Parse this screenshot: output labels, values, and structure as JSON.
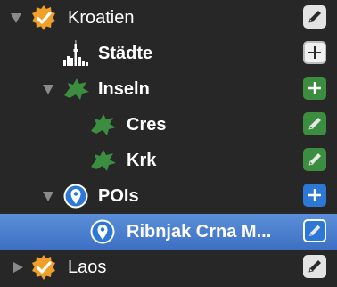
{
  "tree": {
    "items": [
      {
        "label": "Kroatien",
        "icon": "checkmark-badge-icon",
        "action": "edit-icon"
      },
      {
        "label": "Städte",
        "icon": "city-skyline-icon",
        "action": "add-icon"
      },
      {
        "label": "Inseln",
        "icon": "island-icon",
        "action": "add-icon"
      },
      {
        "label": "Cres",
        "icon": "island-icon",
        "action": "edit-icon"
      },
      {
        "label": "Krk",
        "icon": "island-icon",
        "action": "edit-icon"
      },
      {
        "label": "POIs",
        "icon": "location-pin-icon",
        "action": "add-icon"
      },
      {
        "label": "Ribnjak Crna M...",
        "icon": "location-pin-icon",
        "action": "edit-icon",
        "selected": true
      },
      {
        "label": "Laos",
        "icon": "checkmark-badge-icon",
        "action": "edit-icon"
      }
    ]
  },
  "colors": {
    "background": "#272727",
    "selection": "#4a7fcf",
    "island_green": "#3b8d3f",
    "pin_blue": "#2d78d6",
    "badge_orange": "#f0a028"
  }
}
